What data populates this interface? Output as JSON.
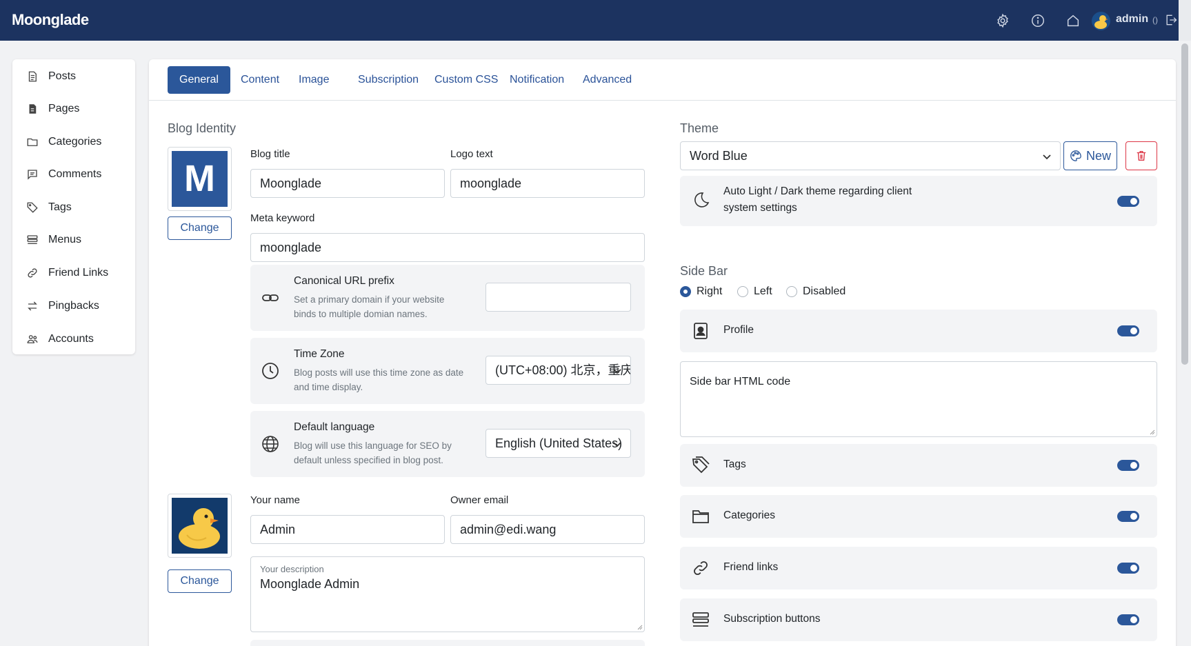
{
  "app": {
    "brand": "Moonglade"
  },
  "topbar": {
    "icons": [
      "gear-icon",
      "info-icon",
      "home-icon",
      "logout-icon"
    ],
    "user_name": "admin",
    "user_extra": "()"
  },
  "sidebar": {
    "items": [
      {
        "label": "Posts",
        "icon": "file-text-icon"
      },
      {
        "label": "Pages",
        "icon": "file-icon"
      },
      {
        "label": "Categories",
        "icon": "folder-icon"
      },
      {
        "label": "Comments",
        "icon": "comment-icon"
      },
      {
        "label": "Tags",
        "icon": "tag-icon"
      },
      {
        "label": "Menus",
        "icon": "menu-icon"
      },
      {
        "label": "Friend Links",
        "icon": "link-icon"
      },
      {
        "label": "Pingbacks",
        "icon": "arrows-icon"
      },
      {
        "label": "Accounts",
        "icon": "people-icon"
      }
    ]
  },
  "tabs": [
    "General",
    "Content",
    "Image",
    "Subscription",
    "Custom CSS",
    "Notification",
    "Advanced"
  ],
  "active_tab": "General",
  "identity": {
    "section_title": "Blog Identity",
    "logo_letter": "M",
    "change_label": "Change",
    "blog_title_label": "Blog title",
    "blog_title_value": "Moonglade",
    "logo_text_label": "Logo text",
    "logo_text_value": "moonglade",
    "meta_keyword_label": "Meta keyword",
    "meta_keyword_value": "moonglade",
    "canonical": {
      "title": "Canonical URL prefix",
      "desc_line1": "Set a primary domain if your website",
      "desc_line2": "binds to multiple domian names.",
      "value": ""
    },
    "timezone": {
      "title": "Time Zone",
      "desc_line1": "Blog posts will use this time zone as date",
      "desc_line2": "and time display.",
      "value": "(UTC+08:00) 北京，重庆"
    },
    "language": {
      "title": "Default language",
      "desc_line1": "Blog will use this language for SEO by",
      "desc_line2": "default unless specified in blog post.",
      "value": "English (United States)"
    },
    "your_name_label": "Your name",
    "your_name_value": "Admin",
    "owner_email_label": "Owner email",
    "owner_email_value": "admin@edi.wang",
    "description_label": "Your description",
    "description_value": "Moonglade Admin"
  },
  "theme": {
    "section_title": "Theme",
    "selected": "Word Blue",
    "new_label": "New",
    "auto_theme_line1": "Auto Light / Dark theme regarding client",
    "auto_theme_line2": "system settings",
    "auto_theme_on": true
  },
  "sidebar_settings": {
    "section_title": "Side Bar",
    "positions": [
      "Right",
      "Left",
      "Disabled"
    ],
    "selected_position": "Right",
    "html_placeholder": "Side bar HTML code",
    "widgets": [
      {
        "label": "Profile",
        "icon": "profile-icon",
        "on": true
      },
      {
        "label": "Tags",
        "icon": "tags-icon",
        "on": true
      },
      {
        "label": "Categories",
        "icon": "folder-icon",
        "on": true
      },
      {
        "label": "Friend links",
        "icon": "link-icon",
        "on": true
      },
      {
        "label": "Subscription buttons",
        "icon": "menu-icon",
        "on": true
      }
    ]
  },
  "colors": {
    "navbar": "#1c3360",
    "accent": "#2b579a",
    "danger": "#dc3545"
  }
}
